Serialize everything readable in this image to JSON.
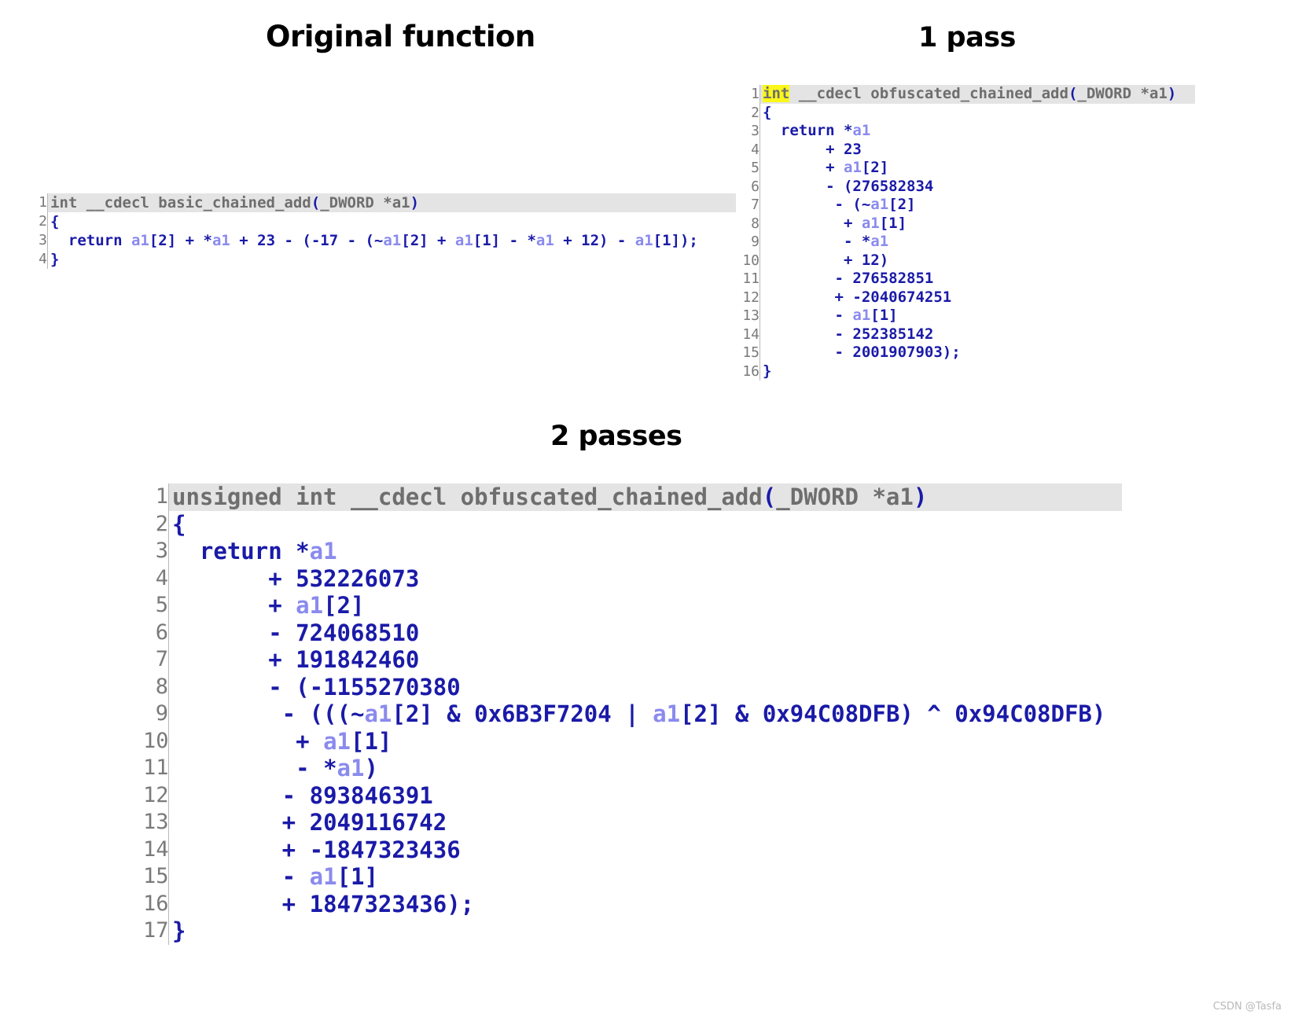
{
  "panels": {
    "original": {
      "title": "Original function"
    },
    "one_pass": {
      "title": "1 pass"
    },
    "two_passes": {
      "title": "2 passes"
    }
  },
  "colors": {
    "signature_gray": "#6e6e6e",
    "keyword_blue": "#1a1aa8",
    "variable_blue": "#8a8aee",
    "highlight_yellow": "#fbf719",
    "signature_background": "#e4e4e4",
    "gutter_gray": "#7a7a7a",
    "background": "#ffffff"
  },
  "original_code": {
    "line_numbers": [
      "1",
      "2",
      "3",
      "4"
    ],
    "lines": [
      "int __cdecl basic_chained_add(_DWORD *a1)",
      "{",
      "  return a1[2] + *a1 + 23 - (-17 - (~a1[2] + a1[1] - *a1 + 12) - a1[1]);",
      "}"
    ],
    "tokens": [
      [
        {
          "t": "int __cdecl basic_chained_add",
          "c": "sig"
        },
        {
          "t": "(",
          "c": "kw"
        },
        {
          "t": "_DWORD *a1",
          "c": "sig"
        },
        {
          "t": ")",
          "c": "kw"
        }
      ],
      [
        {
          "t": "{",
          "c": "kw"
        }
      ],
      [
        {
          "t": "  return ",
          "c": "kw"
        },
        {
          "t": "a1",
          "c": "var"
        },
        {
          "t": "[2] ",
          "c": "kw"
        },
        {
          "t": "+ ",
          "c": "op"
        },
        {
          "t": "*",
          "c": "kw"
        },
        {
          "t": "a1",
          "c": "var"
        },
        {
          "t": " + ",
          "c": "op"
        },
        {
          "t": "23",
          "c": "num"
        },
        {
          "t": " - (",
          "c": "op"
        },
        {
          "t": "-17",
          "c": "num"
        },
        {
          "t": " - (~",
          "c": "op"
        },
        {
          "t": "a1",
          "c": "var"
        },
        {
          "t": "[2] ",
          "c": "kw"
        },
        {
          "t": "+ ",
          "c": "op"
        },
        {
          "t": "a1",
          "c": "var"
        },
        {
          "t": "[1] ",
          "c": "kw"
        },
        {
          "t": "- ",
          "c": "op"
        },
        {
          "t": "*",
          "c": "kw"
        },
        {
          "t": "a1",
          "c": "var"
        },
        {
          "t": " + ",
          "c": "op"
        },
        {
          "t": "12",
          "c": "num"
        },
        {
          "t": ") - ",
          "c": "op"
        },
        {
          "t": "a1",
          "c": "var"
        },
        {
          "t": "[1]);",
          "c": "kw"
        }
      ],
      [
        {
          "t": "}",
          "c": "kw"
        }
      ]
    ]
  },
  "one_pass_code": {
    "line_numbers": [
      "1",
      "2",
      "3",
      "4",
      "5",
      "6",
      "7",
      "8",
      "9",
      "10",
      "11",
      "12",
      "13",
      "14",
      "15",
      "16"
    ],
    "lines": [
      "int __cdecl obfuscated_chained_add(_DWORD *a1)",
      "{",
      "  return *a1",
      "       + 23",
      "       + a1[2]",
      "       - (276582834",
      "        - (~a1[2]",
      "         + a1[1]",
      "         - *a1",
      "         + 12)",
      "        - 276582851",
      "        + -2040674251",
      "        - a1[1]",
      "        - 252385142",
      "        - 2001907903);",
      "}"
    ],
    "highlighted_token": "int",
    "tokens": [
      [
        {
          "t": "int",
          "c": "sig",
          "hl": true
        },
        {
          "t": " __cdecl obfuscated_chained_add",
          "c": "sig"
        },
        {
          "t": "(",
          "c": "kw"
        },
        {
          "t": "_DWORD *a1",
          "c": "sig"
        },
        {
          "t": ")",
          "c": "kw"
        }
      ],
      [
        {
          "t": "{",
          "c": "kw"
        }
      ],
      [
        {
          "t": "  return ",
          "c": "kw"
        },
        {
          "t": "*",
          "c": "kw"
        },
        {
          "t": "a1",
          "c": "var"
        }
      ],
      [
        {
          "t": "       + ",
          "c": "op"
        },
        {
          "t": "23",
          "c": "num"
        }
      ],
      [
        {
          "t": "       + ",
          "c": "op"
        },
        {
          "t": "a1",
          "c": "var"
        },
        {
          "t": "[2]",
          "c": "kw"
        }
      ],
      [
        {
          "t": "       - (",
          "c": "op"
        },
        {
          "t": "276582834",
          "c": "num"
        }
      ],
      [
        {
          "t": "        - (~",
          "c": "op"
        },
        {
          "t": "a1",
          "c": "var"
        },
        {
          "t": "[2]",
          "c": "kw"
        }
      ],
      [
        {
          "t": "         + ",
          "c": "op"
        },
        {
          "t": "a1",
          "c": "var"
        },
        {
          "t": "[1]",
          "c": "kw"
        }
      ],
      [
        {
          "t": "         - ",
          "c": "op"
        },
        {
          "t": "*",
          "c": "kw"
        },
        {
          "t": "a1",
          "c": "var"
        }
      ],
      [
        {
          "t": "         + ",
          "c": "op"
        },
        {
          "t": "12",
          "c": "num"
        },
        {
          "t": ")",
          "c": "kw"
        }
      ],
      [
        {
          "t": "        - ",
          "c": "op"
        },
        {
          "t": "276582851",
          "c": "num"
        }
      ],
      [
        {
          "t": "        + ",
          "c": "op"
        },
        {
          "t": "-2040674251",
          "c": "num"
        }
      ],
      [
        {
          "t": "        - ",
          "c": "op"
        },
        {
          "t": "a1",
          "c": "var"
        },
        {
          "t": "[1]",
          "c": "kw"
        }
      ],
      [
        {
          "t": "        - ",
          "c": "op"
        },
        {
          "t": "252385142",
          "c": "num"
        }
      ],
      [
        {
          "t": "        - ",
          "c": "op"
        },
        {
          "t": "2001907903",
          "c": "num"
        },
        {
          "t": ");",
          "c": "kw"
        }
      ],
      [
        {
          "t": "}",
          "c": "kw"
        }
      ]
    ]
  },
  "two_passes_code": {
    "line_numbers": [
      "1",
      "2",
      "3",
      "4",
      "5",
      "6",
      "7",
      "8",
      "9",
      "10",
      "11",
      "12",
      "13",
      "14",
      "15",
      "16",
      "17"
    ],
    "lines": [
      "unsigned int __cdecl obfuscated_chained_add(_DWORD *a1)",
      "{",
      "  return *a1",
      "       + 532226073",
      "       + a1[2]",
      "       - 724068510",
      "       + 191842460",
      "       - (-1155270380",
      "        - (((~a1[2] & 0x6B3F7204 | a1[2] & 0x94C08DFB) ^ 0x94C08DFB)",
      "         + a1[1]",
      "         - *a1)",
      "        - 893846391",
      "        + 2049116742",
      "        + -1847323436",
      "        - a1[1]",
      "        + 1847323436);",
      "}"
    ],
    "tokens": [
      [
        {
          "t": "unsigned int __cdecl obfuscated_chained_add",
          "c": "sig"
        },
        {
          "t": "(",
          "c": "kw"
        },
        {
          "t": "_DWORD *a1",
          "c": "sig"
        },
        {
          "t": ")",
          "c": "kw"
        }
      ],
      [
        {
          "t": "{",
          "c": "kw"
        }
      ],
      [
        {
          "t": "  return ",
          "c": "kw"
        },
        {
          "t": "*",
          "c": "kw"
        },
        {
          "t": "a1",
          "c": "var"
        }
      ],
      [
        {
          "t": "       + ",
          "c": "op"
        },
        {
          "t": "532226073",
          "c": "num"
        }
      ],
      [
        {
          "t": "       + ",
          "c": "op"
        },
        {
          "t": "a1",
          "c": "var"
        },
        {
          "t": "[2]",
          "c": "kw"
        }
      ],
      [
        {
          "t": "       - ",
          "c": "op"
        },
        {
          "t": "724068510",
          "c": "num"
        }
      ],
      [
        {
          "t": "       + ",
          "c": "op"
        },
        {
          "t": "191842460",
          "c": "num"
        }
      ],
      [
        {
          "t": "       - (",
          "c": "op"
        },
        {
          "t": "-1155270380",
          "c": "num"
        }
      ],
      [
        {
          "t": "        - (((~",
          "c": "op"
        },
        {
          "t": "a1",
          "c": "var"
        },
        {
          "t": "[2] ",
          "c": "kw"
        },
        {
          "t": "& ",
          "c": "op"
        },
        {
          "t": "0x6B3F7204",
          "c": "num"
        },
        {
          "t": " | ",
          "c": "op"
        },
        {
          "t": "a1",
          "c": "var"
        },
        {
          "t": "[2] ",
          "c": "kw"
        },
        {
          "t": "& ",
          "c": "op"
        },
        {
          "t": "0x94C08DFB",
          "c": "num"
        },
        {
          "t": ") ^ ",
          "c": "op"
        },
        {
          "t": "0x94C08DFB",
          "c": "num"
        },
        {
          "t": ")",
          "c": "kw"
        }
      ],
      [
        {
          "t": "         + ",
          "c": "op"
        },
        {
          "t": "a1",
          "c": "var"
        },
        {
          "t": "[1]",
          "c": "kw"
        }
      ],
      [
        {
          "t": "         - ",
          "c": "op"
        },
        {
          "t": "*",
          "c": "kw"
        },
        {
          "t": "a1",
          "c": "var"
        },
        {
          "t": ")",
          "c": "kw"
        }
      ],
      [
        {
          "t": "        - ",
          "c": "op"
        },
        {
          "t": "893846391",
          "c": "num"
        }
      ],
      [
        {
          "t": "        + ",
          "c": "op"
        },
        {
          "t": "2049116742",
          "c": "num"
        }
      ],
      [
        {
          "t": "        + ",
          "c": "op"
        },
        {
          "t": "-1847323436",
          "c": "num"
        }
      ],
      [
        {
          "t": "        - ",
          "c": "op"
        },
        {
          "t": "a1",
          "c": "var"
        },
        {
          "t": "[1]",
          "c": "kw"
        }
      ],
      [
        {
          "t": "        + ",
          "c": "op"
        },
        {
          "t": "1847323436",
          "c": "num"
        },
        {
          "t": ");",
          "c": "kw"
        }
      ],
      [
        {
          "t": "}",
          "c": "kw"
        }
      ]
    ]
  },
  "watermark": {
    "text": "CSDN @Tasfa"
  }
}
